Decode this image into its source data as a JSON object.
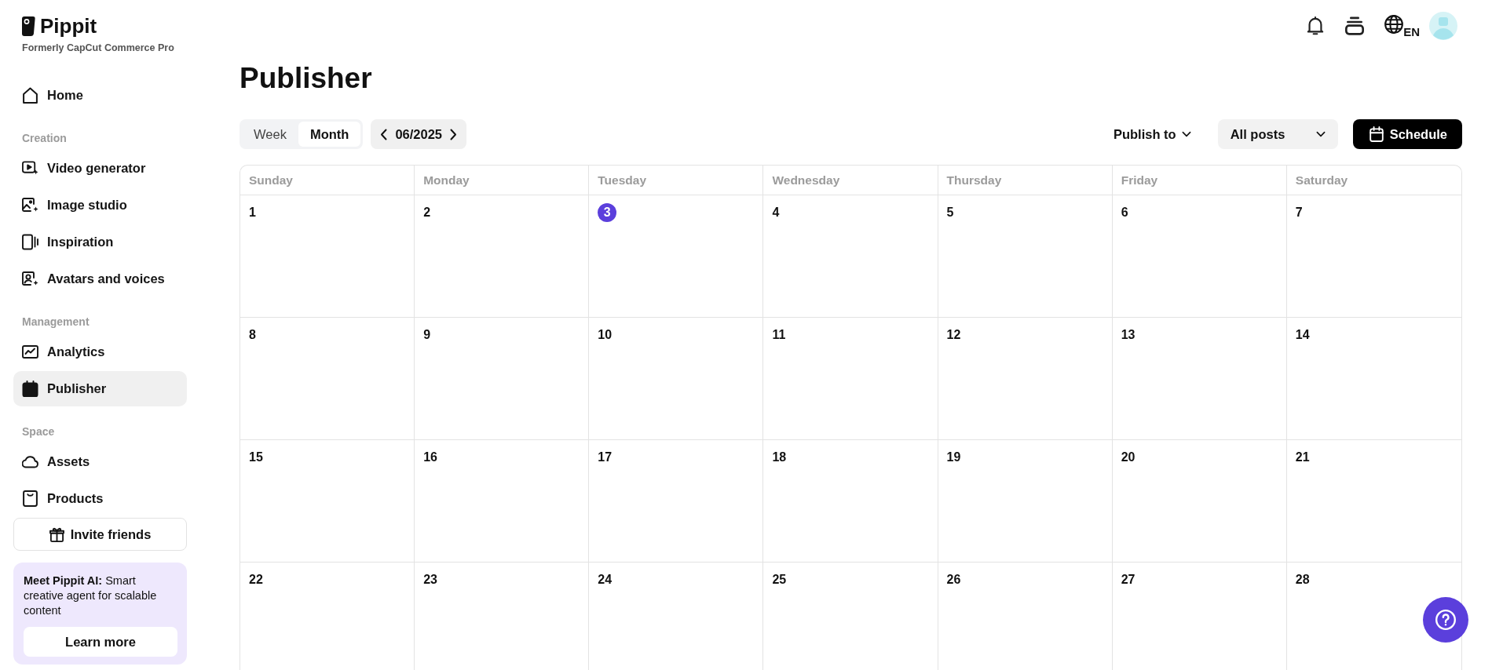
{
  "brand": {
    "name": "Pippit",
    "subtitle": "Formerly CapCut Commerce Pro"
  },
  "sidebar": {
    "sections": [
      {
        "items": [
          {
            "label": "Home",
            "selected": false
          }
        ]
      },
      {
        "heading": "Creation",
        "items": [
          {
            "label": "Video generator",
            "selected": false
          },
          {
            "label": "Image studio",
            "selected": false
          },
          {
            "label": "Inspiration",
            "selected": false
          },
          {
            "label": "Avatars and voices",
            "selected": false
          }
        ]
      },
      {
        "heading": "Management",
        "items": [
          {
            "label": "Analytics",
            "selected": false
          },
          {
            "label": "Publisher",
            "selected": true
          }
        ]
      },
      {
        "heading": "Space",
        "items": [
          {
            "label": "Assets",
            "selected": false
          },
          {
            "label": "Products",
            "selected": false
          }
        ]
      }
    ],
    "invite_button": "Invite friends",
    "promo": {
      "text": "**Meet Pippit AI:** Smart creative agent for scalable content",
      "button": "Learn more"
    }
  },
  "header": {
    "language": "EN"
  },
  "page_title": "Publisher",
  "toolbar": {
    "view_tabs": [
      {
        "label": "Week",
        "selected": false
      },
      {
        "label": "Month",
        "selected": true
      }
    ],
    "period": "06/2025",
    "publish_to": "Publish to",
    "post_filter": "All posts",
    "schedule_button": "Schedule"
  },
  "calendar": {
    "weekdays": [
      "Sunday",
      "Monday",
      "Tuesday",
      "Wednesday",
      "Thursday",
      "Friday",
      "Saturday"
    ],
    "weeks": [
      [
        {
          "day": "1",
          "today": false
        },
        {
          "day": "2",
          "today": false
        },
        {
          "day": "3",
          "today": true
        },
        {
          "day": "4",
          "today": false
        },
        {
          "day": "5",
          "today": false
        },
        {
          "day": "6",
          "today": false
        },
        {
          "day": "7",
          "today": false
        }
      ],
      [
        {
          "day": "8",
          "today": false
        },
        {
          "day": "9",
          "today": false
        },
        {
          "day": "10",
          "today": false
        },
        {
          "day": "11",
          "today": false
        },
        {
          "day": "12",
          "today": false
        },
        {
          "day": "13",
          "today": false
        },
        {
          "day": "14",
          "today": false
        }
      ],
      [
        {
          "day": "15",
          "today": false
        },
        {
          "day": "16",
          "today": false
        },
        {
          "day": "17",
          "today": false
        },
        {
          "day": "18",
          "today": false
        },
        {
          "day": "19",
          "today": false
        },
        {
          "day": "20",
          "today": false
        },
        {
          "day": "21",
          "today": false
        }
      ],
      [
        {
          "day": "22",
          "today": false
        },
        {
          "day": "23",
          "today": false
        },
        {
          "day": "24",
          "today": false
        },
        {
          "day": "25",
          "today": false
        },
        {
          "day": "26",
          "today": false
        },
        {
          "day": "27",
          "today": false
        },
        {
          "day": "28",
          "today": false
        }
      ]
    ]
  }
}
